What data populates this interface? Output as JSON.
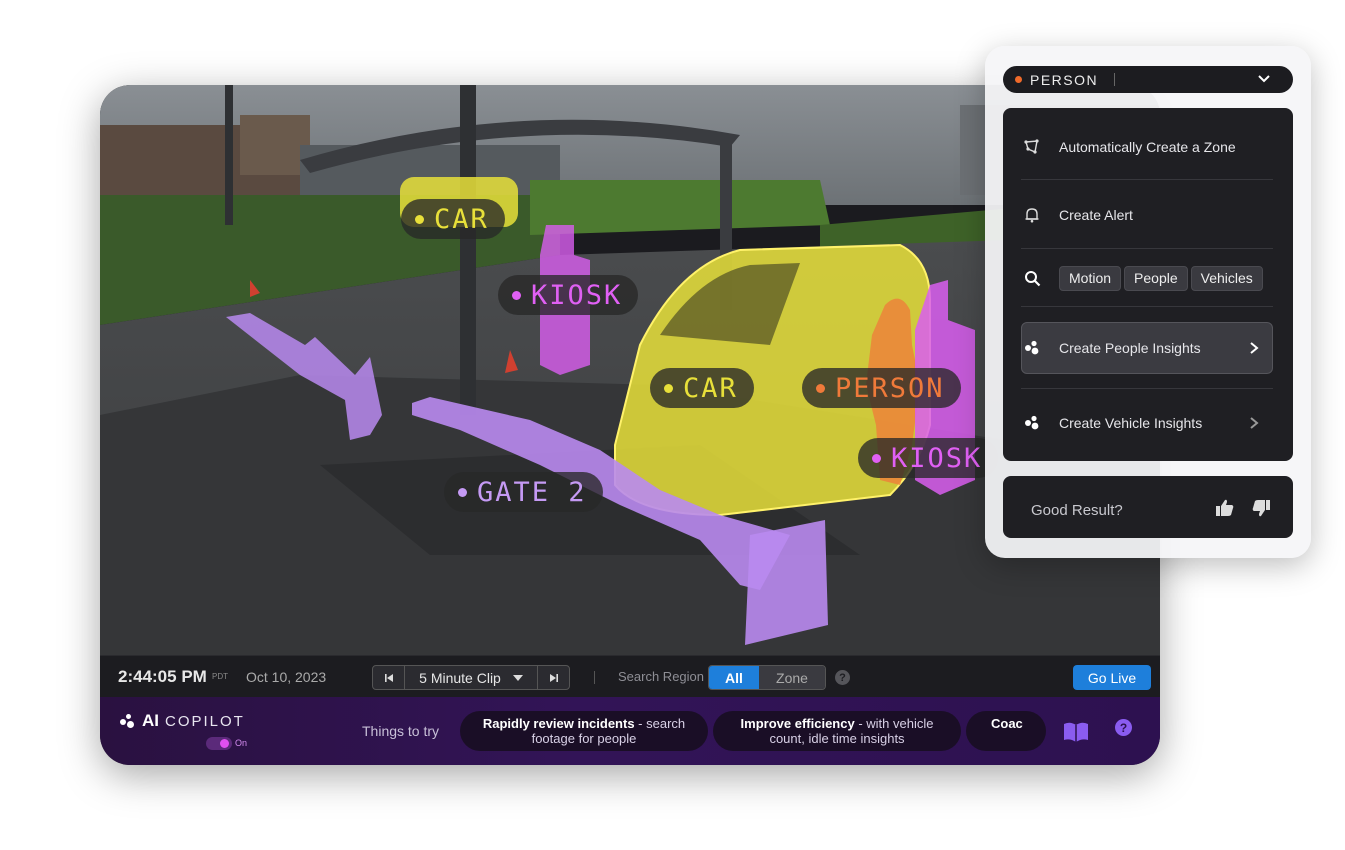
{
  "labels": {
    "car_1": "CAR",
    "kiosk_1": "KIOSK",
    "car_2": "CAR",
    "person": "PERSON",
    "kiosk_2": "KIOSK",
    "gate": "GATE 2"
  },
  "colors": {
    "car": "#e8e03a",
    "kiosk": "#d95ef0",
    "gate": "#b98af0",
    "person": "#f07a3a",
    "accent_blue": "#1e7fdb"
  },
  "control_bar": {
    "time": "2:44:05 PM",
    "timezone": "PDT",
    "date": "Oct 10, 2023",
    "clip_label": "5 Minute Clip",
    "search_region_label": "Search Region",
    "region_all": "All",
    "region_zone": "Zone",
    "go_live": "Go Live"
  },
  "copilot": {
    "ai": "AI",
    "name": "COPILOT",
    "toggle": "On",
    "things_to_try": "Things to try",
    "suggestions": [
      {
        "bold": "Rapidly review incidents",
        "rest": " - search",
        "line2": "footage for people"
      },
      {
        "bold": "Improve efficiency",
        "rest": " - with vehicle",
        "line2": "count, idle time insights"
      },
      {
        "bold": "Coac",
        "rest": "",
        "line2": ""
      }
    ]
  },
  "panel": {
    "object_type": "PERSON",
    "menu": {
      "auto_zone": "Automatically Create a  Zone",
      "create_alert": "Create Alert",
      "filters": [
        "Motion",
        "People",
        "Vehicles"
      ],
      "people_insights": "Create People Insights",
      "vehicle_insights": "Create Vehicle Insights"
    },
    "feedback": "Good Result?"
  }
}
